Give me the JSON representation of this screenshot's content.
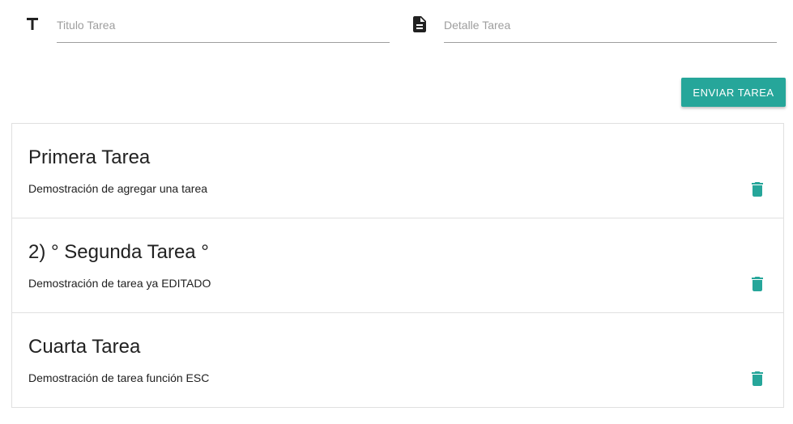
{
  "form": {
    "title_field": {
      "placeholder": "Titulo Tarea",
      "value": "",
      "icon": "title-icon"
    },
    "detail_field": {
      "placeholder": "Detalle Tarea",
      "value": "",
      "icon": "description-icon"
    },
    "submit_label": "ENVIAR TAREA"
  },
  "tasks": [
    {
      "title": "Primera Tarea",
      "detail": "Demostración de agregar una tarea",
      "icon": "delete-icon"
    },
    {
      "title": "2) ° Segunda Tarea °",
      "detail": "Demostración de tarea ya EDITADO",
      "icon": "delete-icon"
    },
    {
      "title": "Cuarta Tarea",
      "detail": "Demostración de tarea función ESC",
      "icon": "delete-icon"
    }
  ],
  "colors": {
    "accent": "#26a69a",
    "text": "#212121",
    "placeholder": "#9e9e9e",
    "divider": "#e0e0e0"
  }
}
